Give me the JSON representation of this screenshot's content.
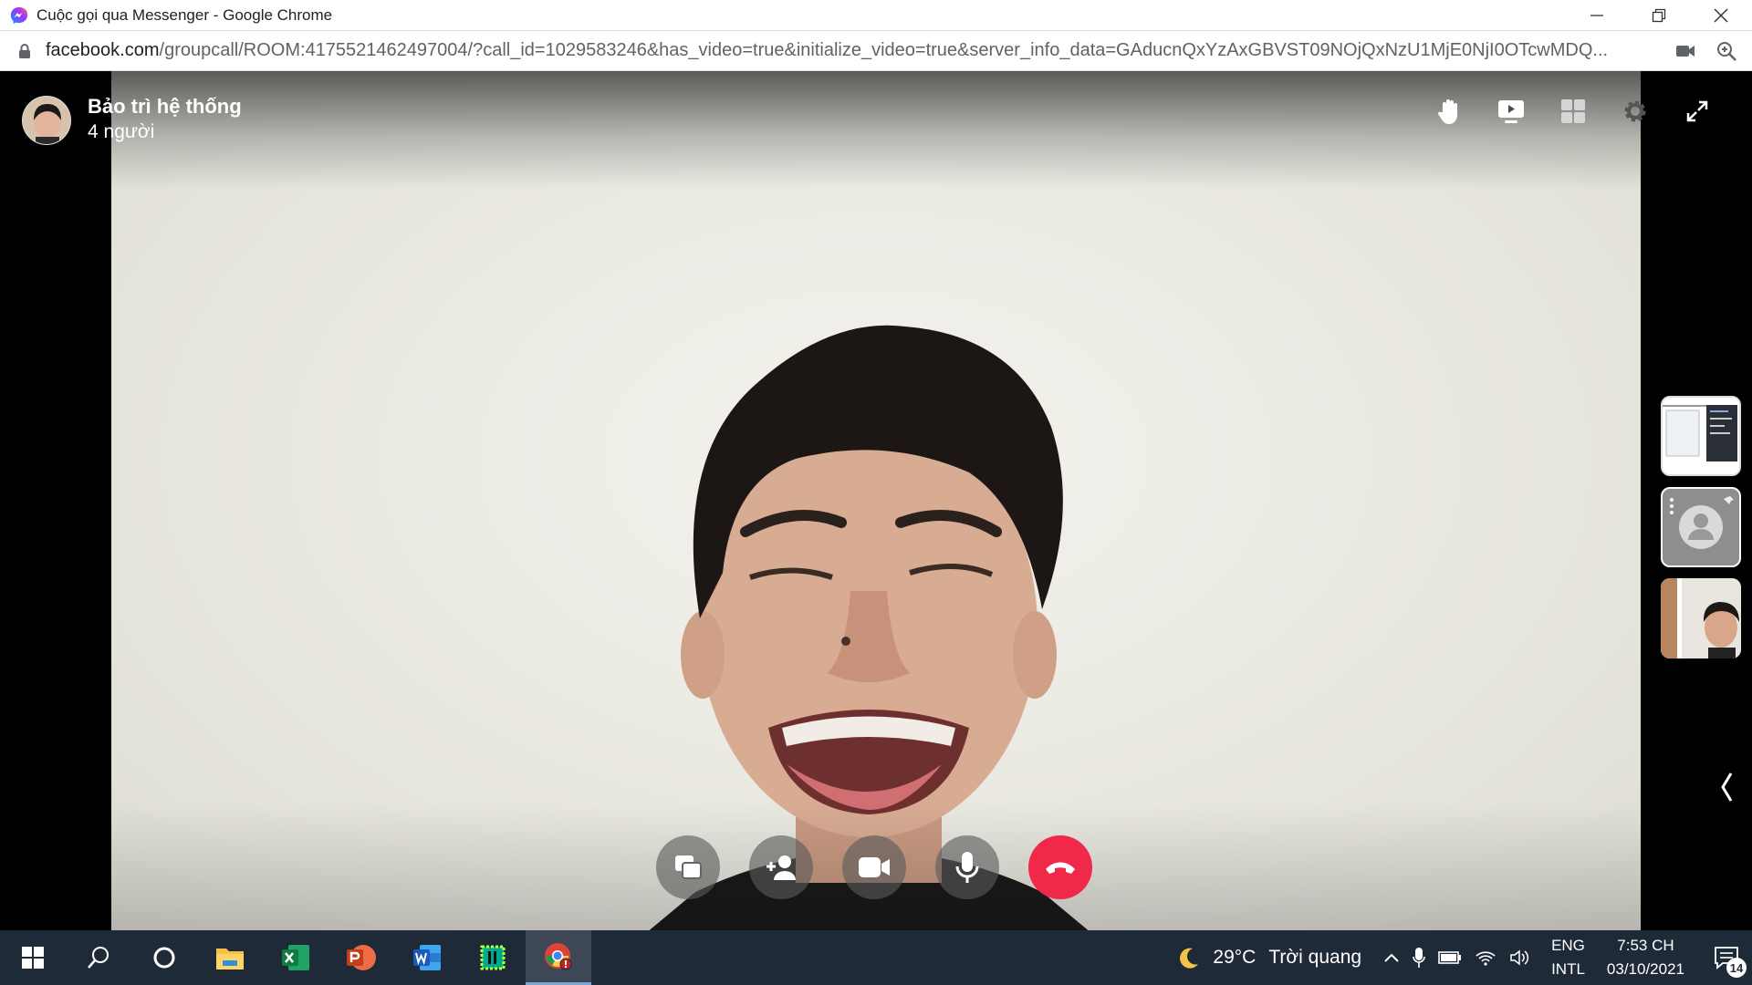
{
  "window": {
    "title": "Cuộc gọi qua Messenger - Google Chrome",
    "favicon": "messenger-icon",
    "controls": [
      "minimize-icon",
      "restore-icon",
      "close-icon"
    ]
  },
  "address": {
    "host": "facebook.com",
    "path": "/groupcall/ROOM:4175521462497004/?call_id=1029583246&has_video=true&initialize_video=true&server_info_data=GAducnQxYzAxGBVST09NOjQxNzU1MjE0NjI0OTcwMDQ...",
    "indicators": [
      "camera-in-use-icon",
      "zoom-icon"
    ]
  },
  "call": {
    "title": "Bảo trì hệ thống",
    "participants": "4 người",
    "top_tools": [
      "raise-hand-icon",
      "share-video-icon",
      "grid-view-icon",
      "settings-icon",
      "fullscreen-icon"
    ],
    "controls": [
      "share-screen-icon",
      "add-person-icon",
      "camera-icon",
      "microphone-icon",
      "end-call-icon"
    ],
    "end_color": "#f02849"
  },
  "taskbar": {
    "apps": [
      "windows-start-icon",
      "search-icon",
      "cortana-icon",
      "file-explorer-icon",
      "excel-icon",
      "powerpoint-icon",
      "word-icon",
      "kaspersky-icon",
      "chrome-icon"
    ],
    "weather": {
      "temp": "29°C",
      "condition": "Trời quang"
    },
    "lang": {
      "line1": "ENG",
      "line2": "INTL"
    },
    "clock": {
      "time": "7:53 CH",
      "date": "03/10/2021"
    },
    "notifications": "14"
  }
}
